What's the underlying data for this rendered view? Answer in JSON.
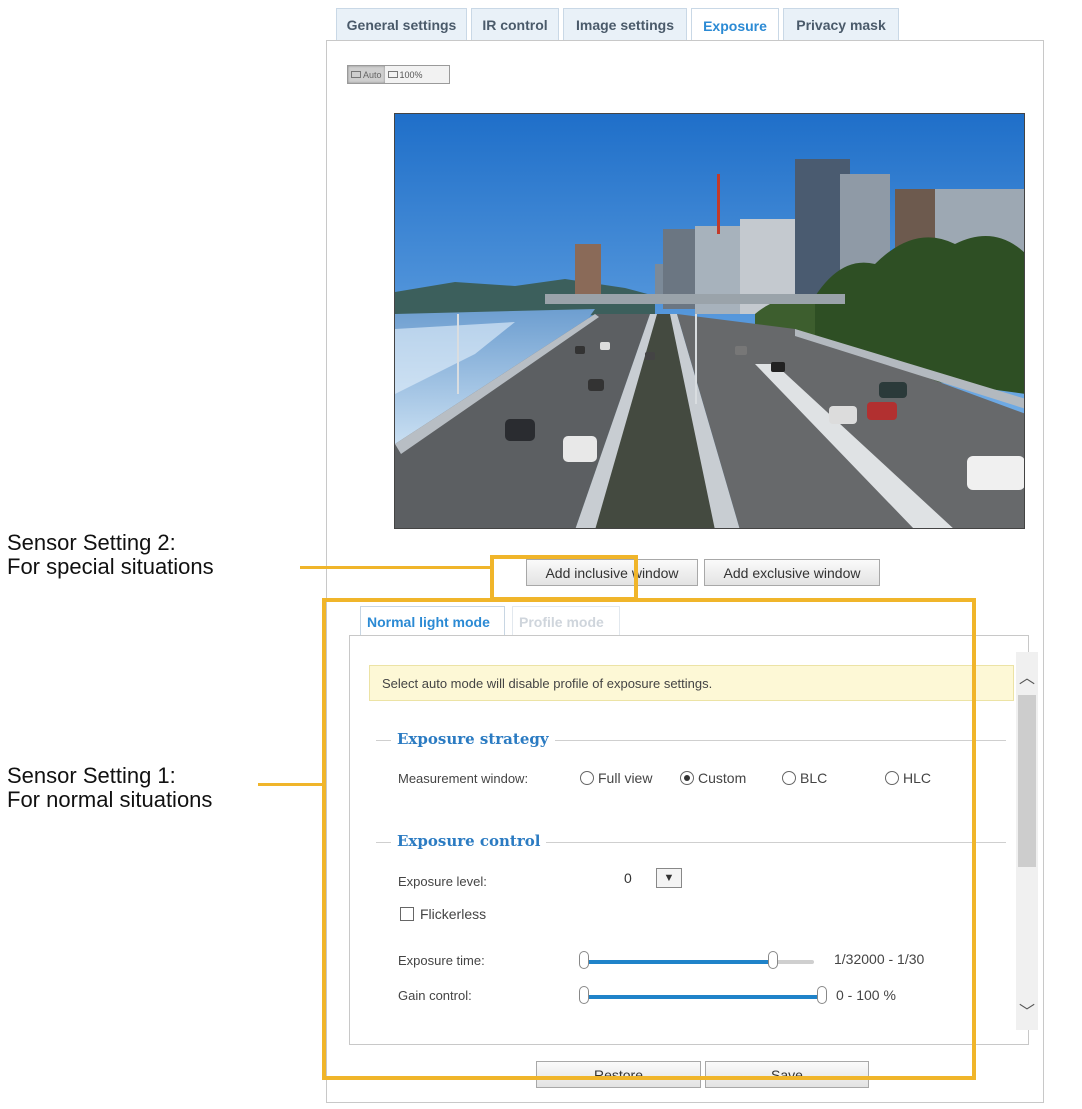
{
  "top_tabs": [
    {
      "label": "General settings",
      "active": false
    },
    {
      "label": "IR control",
      "active": false
    },
    {
      "label": "Image settings",
      "active": false
    },
    {
      "label": "Exposure",
      "active": true
    },
    {
      "label": "Privacy mask",
      "active": false
    }
  ],
  "view_toggle": {
    "auto_label": "Auto",
    "full_label": "100%"
  },
  "buttons": {
    "add_inclusive": "Add inclusive window",
    "add_exclusive": "Add exclusive window",
    "restore": "Restore",
    "save": "Save"
  },
  "inner_tabs": [
    {
      "label": "Normal light mode",
      "active": true
    },
    {
      "label": "Profile mode",
      "active": false
    }
  ],
  "notice": "Select auto mode will disable profile of exposure settings.",
  "exposure_strategy": {
    "title": "Exposure strategy",
    "measurement_label": "Measurement window:",
    "options": [
      {
        "label": "Full view",
        "checked": false
      },
      {
        "label": "Custom",
        "checked": true
      },
      {
        "label": "BLC",
        "checked": false
      },
      {
        "label": "HLC",
        "checked": false
      }
    ]
  },
  "exposure_control": {
    "title": "Exposure control",
    "level_label": "Exposure level:",
    "level_value": "0",
    "flickerless_label": "Flickerless",
    "flickerless_checked": false,
    "time_label": "Exposure time:",
    "time_value": "1/32000 - 1/30",
    "time_range_fraction": [
      0,
      0.82
    ],
    "gain_label": "Gain control:",
    "gain_value": "0 - 100 %",
    "gain_range_fraction": [
      0,
      1.0
    ]
  },
  "annotations": {
    "sensor2_line1": "Sensor Setting 2:",
    "sensor2_line2": "For special situations",
    "sensor1_line1": "Sensor Setting 1:",
    "sensor1_line2": "For normal situations",
    "highlight_color": "#f0b52a"
  },
  "colors": {
    "tab_active": "#2b8ad4",
    "section_title": "#2b7bc2",
    "slider_fill": "#1f83c9"
  }
}
